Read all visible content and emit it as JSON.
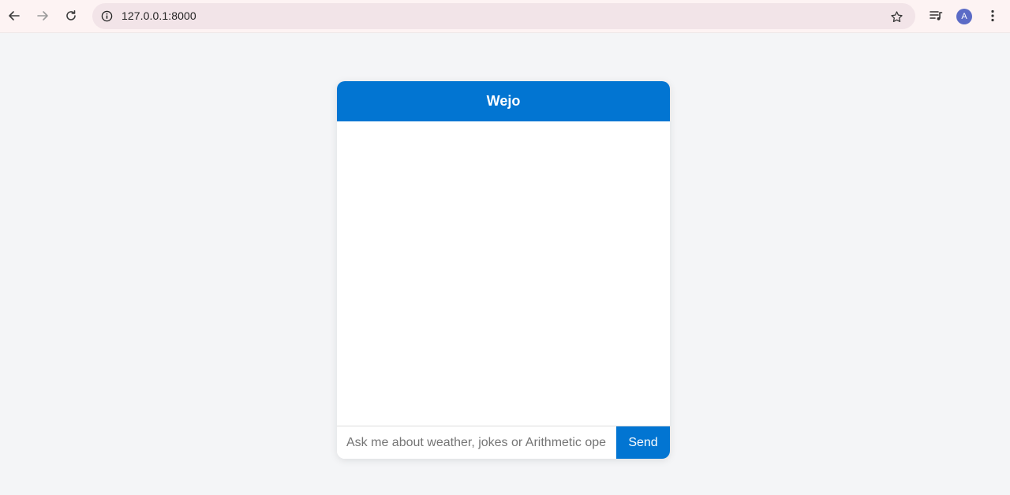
{
  "browser": {
    "url": "127.0.0.1:8000",
    "profile_initial": "A",
    "icons": {
      "back": "arrow-left",
      "forward": "arrow-right",
      "reload": "reload",
      "site_info": "info",
      "bookmark": "star",
      "media": "playlist",
      "menu": "more-vertical"
    }
  },
  "chat": {
    "title": "Wejo",
    "input_placeholder": "Ask me about weather, jokes or Arithmetic operations",
    "input_value": "",
    "send_label": "Send",
    "messages": [],
    "colors": {
      "accent": "#0275d2",
      "background": "#f4f5f7"
    }
  }
}
